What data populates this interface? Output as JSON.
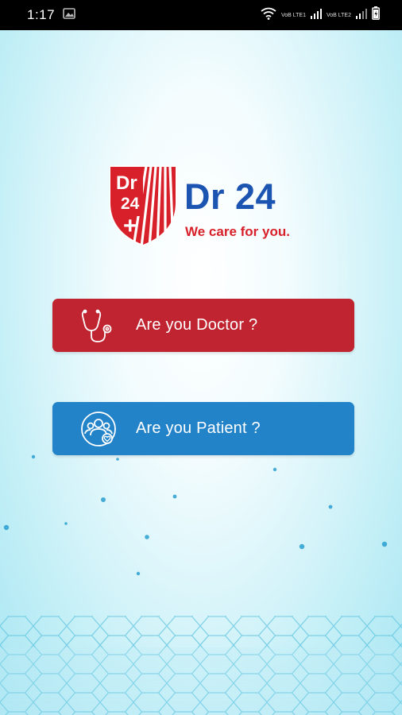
{
  "status_bar": {
    "time": "1:17",
    "network_labels": [
      "VoB LTE1",
      "VoB LTE2"
    ]
  },
  "brand": {
    "logo_text_top": "Dr",
    "logo_text_mid": "24",
    "logo_text_plus": "+",
    "name": "Dr 24",
    "tagline": "We care for you."
  },
  "buttons": {
    "doctor_label": "Are you Doctor ?",
    "patient_label": "Are you Patient ?"
  },
  "colors": {
    "doctor_button": "#bf2430",
    "patient_button": "#2383c9",
    "brand_blue": "#1c54b2",
    "brand_red": "#d8202a"
  },
  "icons": {
    "doctor": "stethoscope-icon",
    "patient": "people-heart-icon"
  }
}
